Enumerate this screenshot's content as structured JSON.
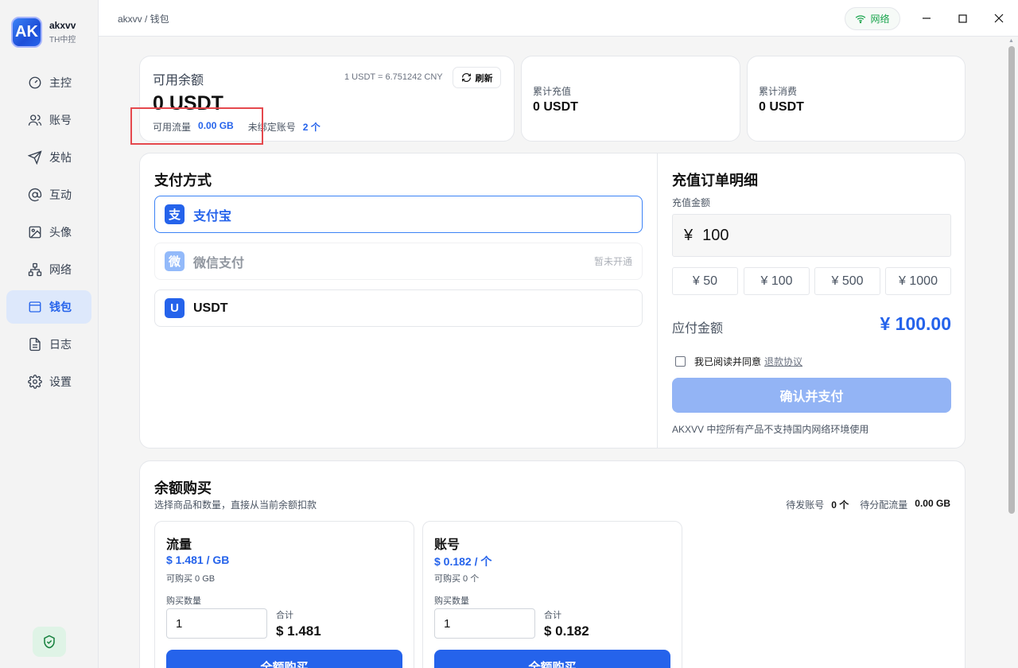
{
  "app": {
    "logo_text": "AK",
    "name": "akxvv",
    "subtitle": "TH中控"
  },
  "sidebar": {
    "items": [
      {
        "label": "主控",
        "icon": "gauge-icon"
      },
      {
        "label": "账号",
        "icon": "users-icon"
      },
      {
        "label": "发帖",
        "icon": "send-icon"
      },
      {
        "label": "互动",
        "icon": "at-icon"
      },
      {
        "label": "头像",
        "icon": "image-icon"
      },
      {
        "label": "网络",
        "icon": "network-icon"
      },
      {
        "label": "钱包",
        "icon": "wallet-icon",
        "active": true
      },
      {
        "label": "日志",
        "icon": "file-text-icon"
      },
      {
        "label": "设置",
        "icon": "gear-icon"
      }
    ]
  },
  "topbar": {
    "breadcrumb": "akxvv / 钱包",
    "network_label": "网络",
    "window_controls": [
      "minimize",
      "maximize",
      "close"
    ]
  },
  "balance": {
    "title": "可用余额",
    "rate": "1 USDT = 6.751242 CNY",
    "refresh_label": "刷新",
    "amount": "0 USDT",
    "traffic_label": "可用流量",
    "traffic_value": "0.00 GB",
    "unbound_label": "未绑定账号",
    "unbound_value": "2 个"
  },
  "stats": {
    "total_recharge_label": "累计充值",
    "total_recharge_value": "0 USDT",
    "total_spend_label": "累计消费",
    "total_spend_value": "0 USDT"
  },
  "payment": {
    "title": "支付方式",
    "options": [
      {
        "icon_text": "支",
        "label": "支付宝",
        "selected": true,
        "note": ""
      },
      {
        "icon_text": "微",
        "label": "微信支付",
        "disabled": true,
        "note": "暂未开通"
      },
      {
        "icon_text": "U",
        "label": "USDT",
        "note": ""
      }
    ]
  },
  "order": {
    "title": "充值订单明细",
    "amount_label": "充值金额",
    "currency_symbol": "¥",
    "amount_value": "100",
    "quick_amounts": [
      "¥ 50",
      "¥ 100",
      "¥ 500",
      "¥ 1000"
    ],
    "due_label": "应付金额",
    "due_value": "¥ 100.00",
    "agree_text": "我已阅读并同意",
    "agree_link": "退款协议",
    "confirm_label": "确认并支付",
    "disclaimer": "AKXVV 中控所有产品不支持国内网络环境使用"
  },
  "purchase": {
    "title": "余额购买",
    "subtitle": "选择商品和数量，直接从当前余额扣款",
    "pending_accounts_label": "待发账号",
    "pending_accounts_value": "0 个",
    "pending_traffic_label": "待分配流量",
    "pending_traffic_value": "0.00 GB",
    "products": [
      {
        "name": "流量",
        "price": "$ 1.481 / GB",
        "available": "可购买 0 GB",
        "qty_label": "购买数量",
        "qty": "1",
        "total_label": "合计",
        "total": "$ 1.481",
        "buy_label": "全额购买"
      },
      {
        "name": "账号",
        "price": "$ 0.182 / 个",
        "available": "可购买 0 个",
        "qty_label": "购买数量",
        "qty": "1",
        "total_label": "合计",
        "total": "$ 0.182",
        "buy_label": "全额购买"
      }
    ]
  },
  "colors": {
    "accent": "#2563eb",
    "highlight_box": "#e5484d",
    "success": "#16a34a"
  }
}
